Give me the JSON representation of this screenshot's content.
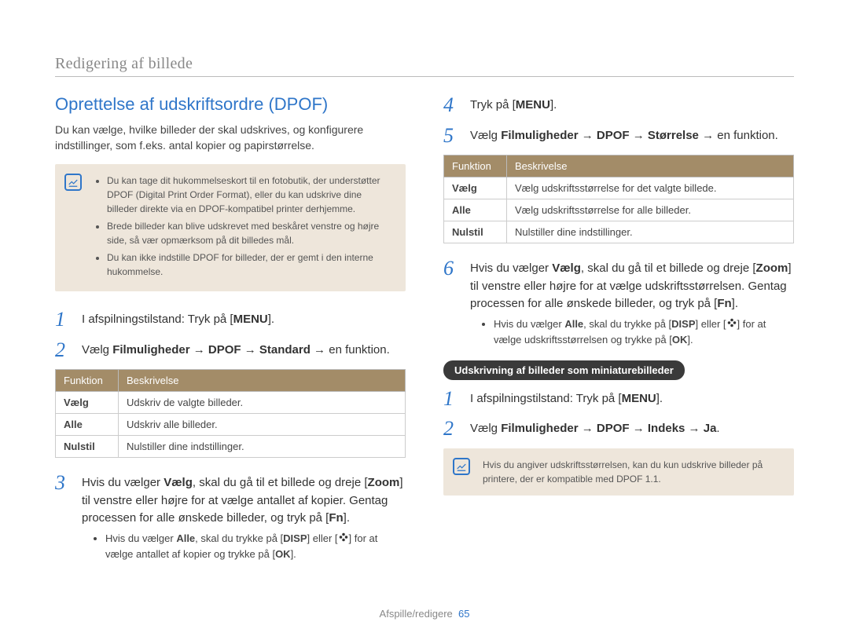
{
  "header": "Redigering af billede",
  "left": {
    "title": "Oprettelse af udskriftsordre (DPOF)",
    "intro": "Du kan vælge, hvilke billeder der skal udskrives, og konfigurere indstillinger, som f.eks. antal kopier og papirstørrelse.",
    "notes": [
      "Du kan tage dit hukommelseskort til en fotobutik, der understøtter DPOF (Digital Print Order Format), eller du kan udskrive dine billeder direkte via en DPOF-kompatibel printer derhjemme.",
      "Brede billeder kan blive udskrevet med beskåret venstre og højre side, så vær opmærksom på dit billedes mål.",
      "Du kan ikke indstille DPOF for billeder, der er gemt i den interne hukommelse."
    ],
    "step1": {
      "pre": "I afspilningstilstand: Tryk på [",
      "btn": "MENU",
      "post": "]."
    },
    "step2": {
      "pre": "Vælg ",
      "path": "Filmuligheder → DPOF → Standard",
      "post": " → en funktion."
    },
    "table_headers": {
      "c1": "Funktion",
      "c2": "Beskrivelse"
    },
    "table_rows": [
      {
        "k": "Vælg",
        "v": "Udskriv de valgte billeder."
      },
      {
        "k": "Alle",
        "v": "Udskriv alle billeder."
      },
      {
        "k": "Nulstil",
        "v": "Nulstiller dine indstillinger."
      }
    ],
    "step3": {
      "pre": "Hvis du vælger ",
      "b1": "Vælg",
      "mid1": ", skal du gå til et billede og dreje [",
      "b2": "Zoom",
      "mid2": "] til venstre eller højre for at vælge antallet af kopier. Gentag processen for alle ønskede billeder, og tryk på [",
      "b3": "Fn",
      "post": "]."
    },
    "sub3": {
      "pre": "Hvis du vælger ",
      "b1": "Alle",
      "mid1": ", skal du trykke på [",
      "b2": "DISP",
      "mid2": "] eller [",
      "mid3": "] for at vælge antallet af kopier og trykke på [",
      "b3": "OK",
      "post": "]."
    }
  },
  "right": {
    "step4": {
      "pre": "Tryk på [",
      "btn": "MENU",
      "post": "]."
    },
    "step5": {
      "pre": "Vælg ",
      "path": "Filmuligheder → DPOF → Størrelse",
      "post": " → en funktion."
    },
    "table_headers": {
      "c1": "Funktion",
      "c2": "Beskrivelse"
    },
    "table_rows": [
      {
        "k": "Vælg",
        "v": "Vælg udskriftsstørrelse for det valgte billede."
      },
      {
        "k": "Alle",
        "v": "Vælg udskriftsstørrelse for alle billeder."
      },
      {
        "k": "Nulstil",
        "v": "Nulstiller dine indstillinger."
      }
    ],
    "step6": {
      "pre": "Hvis du vælger ",
      "b1": "Vælg",
      "mid1": ", skal du gå til et billede og dreje [",
      "b2": "Zoom",
      "mid2": "] til venstre eller højre for at vælge udskriftsstørrelsen. Gentag processen for alle ønskede billeder, og tryk på [",
      "b3": "Fn",
      "post": "]."
    },
    "sub6": {
      "pre": "Hvis du vælger ",
      "b1": "Alle",
      "mid1": ", skal du trykke på [",
      "b2": "DISP",
      "mid2": "] eller [",
      "mid3": "] for at vælge udskriftsstørrelsen og trykke på [",
      "b3": "OK",
      "post": "]."
    },
    "pill": "Udskrivning af billeder som miniaturebilleder",
    "t_step1": {
      "pre": "I afspilningstilstand: Tryk på [",
      "btn": "MENU",
      "post": "]."
    },
    "t_step2": {
      "pre": "Vælg ",
      "path": "Filmuligheder → DPOF → Indeks → Ja",
      "post": "."
    },
    "endnote": "Hvis du angiver udskriftsstørrelsen, kan du kun udskrive billeder på printere, der er kompatible med DPOF 1.1."
  },
  "footer": {
    "section": "Afspille/redigere",
    "page": "65"
  }
}
